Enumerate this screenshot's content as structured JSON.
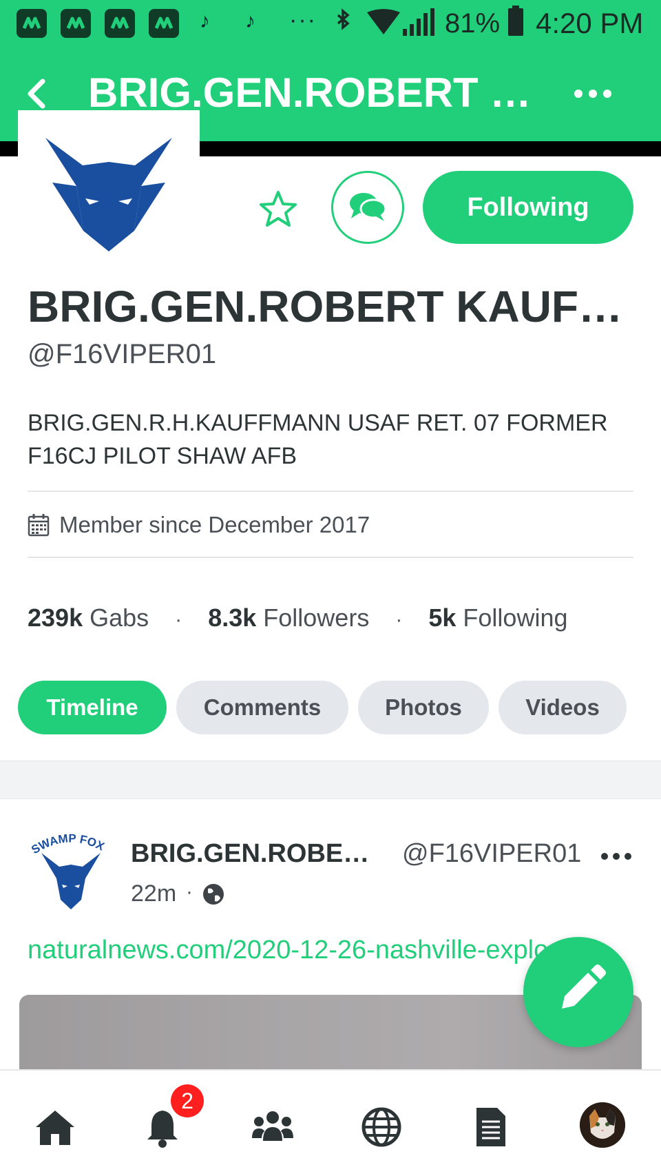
{
  "status_bar": {
    "battery": "81%",
    "time": "4:20 PM"
  },
  "app_bar": {
    "title": "BRIG.GEN.ROBERT K..."
  },
  "profile": {
    "name": "BRIG.GEN.ROBERT KAUFFMA...",
    "handle": "@F16VIPER01",
    "bio": "BRIG.GEN.R.H.KAUFFMANN USAF RET. 07 FORMER F16CJ PILOT SHAW AFB",
    "member_since": "Member since December 2017",
    "follow_label": "Following"
  },
  "stats": [
    {
      "value": "239k",
      "label": "Gabs"
    },
    {
      "value": "8.3k",
      "label": "Followers"
    },
    {
      "value": "5k",
      "label": "Following"
    }
  ],
  "tabs": [
    {
      "label": "Timeline",
      "active": true
    },
    {
      "label": "Comments",
      "active": false
    },
    {
      "label": "Photos",
      "active": false
    },
    {
      "label": "Videos",
      "active": false
    }
  ],
  "post": {
    "author": "BRIG.GEN.ROBERT ...",
    "handle": "@F16VIPER01",
    "time": "22m",
    "separator": "·",
    "link": "naturalnews.com/2020-12-26-nashville-explo...",
    "avatar_text": "SWAMP FOX"
  },
  "bottom_nav": {
    "notifications_badge": "2",
    "items": [
      "home-icon",
      "bell-icon",
      "groups-icon",
      "globe-icon",
      "news-icon",
      "avatar"
    ]
  },
  "colors": {
    "brand_green": "#21cf7b",
    "fox_blue": "#1a4fa0",
    "badge_red": "#ff1f1f"
  }
}
